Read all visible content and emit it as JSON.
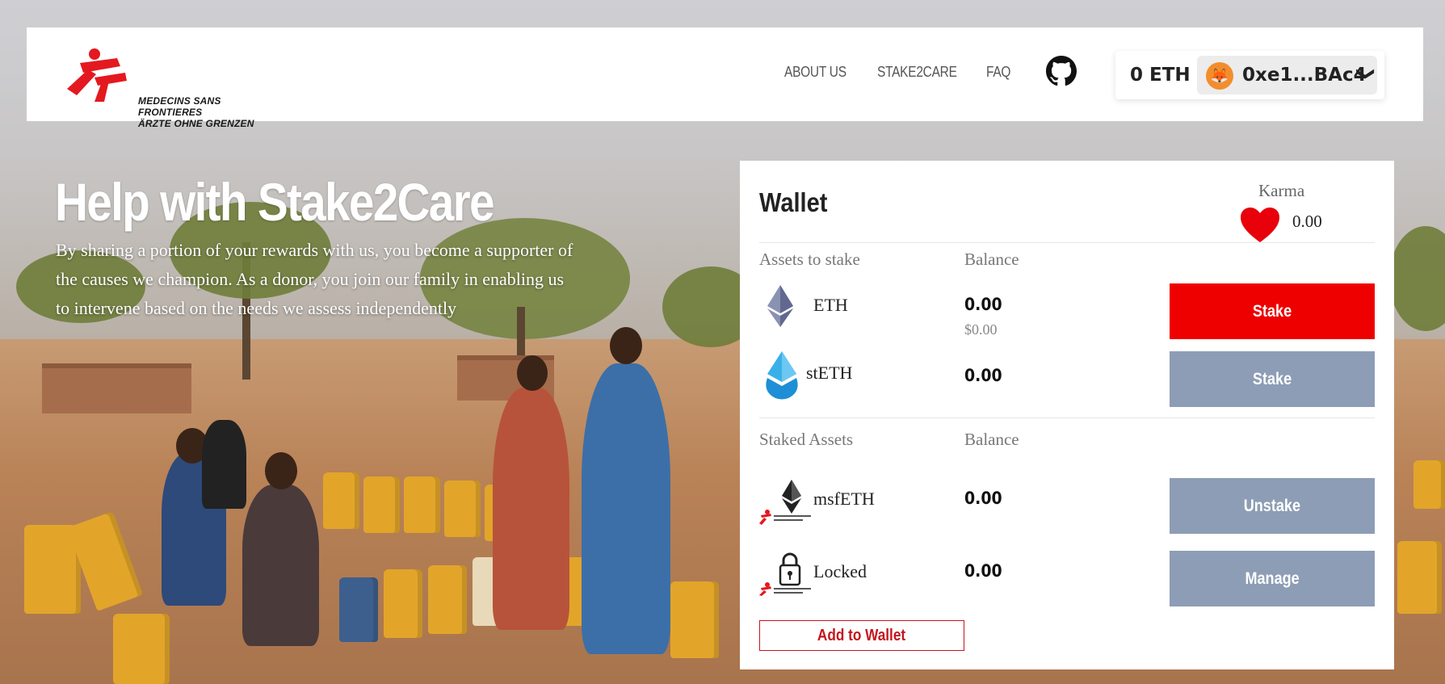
{
  "header": {
    "logo_line1": "MEDECINS SANS FRONTIERES",
    "logo_line2": "ÄRZTE OHNE GRENZEN",
    "nav": [
      "ABOUT US",
      "STAKE2CARE",
      "FAQ"
    ],
    "wallet_balance": "0 ETH",
    "address": "0xe1...BAc4",
    "fox_icon": "🦊",
    "chevron": "❯"
  },
  "hero": {
    "title": "Help with Stake2Care",
    "body": "By sharing a portion of your rewards with us, you become a supporter of the causes we champion. As a donor, you join our family in enabling us to intervene based on the needs we assess independently"
  },
  "wallet": {
    "title": "Wallet",
    "karma_label": "Karma",
    "karma_value": "0.00",
    "assets_header": "Assets to stake",
    "balance_header": "Balance",
    "assets": [
      {
        "name": "ETH",
        "balance": "0.00",
        "usd": "$0.00",
        "action": "Stake",
        "icon": "eth-icon"
      },
      {
        "name": "stETH",
        "balance": "0.00",
        "action": "Stake",
        "icon": "steth-icon"
      }
    ],
    "staked_header": "Staked Assets",
    "staked_balance_header": "Balance",
    "staked": [
      {
        "name": "msfETH",
        "balance": "0.00",
        "action": "Unstake",
        "icon": "msfeth-icon"
      },
      {
        "name": "Locked",
        "balance": "0.00",
        "action": "Manage",
        "icon": "lock-icon"
      }
    ],
    "add_to_wallet": "Add to Wallet"
  },
  "colors": {
    "brand_red": "#ee0000",
    "button_grey": "#8d9db5",
    "outline_red": "#c4151c"
  }
}
